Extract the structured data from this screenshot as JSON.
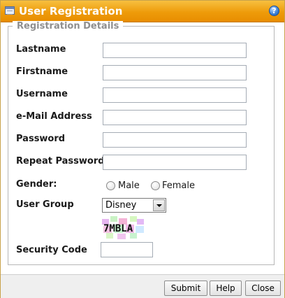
{
  "window": {
    "title": "User Registration",
    "title_icon": "window-form-icon",
    "help_icon": "help-icon",
    "help_glyph": "?"
  },
  "form": {
    "legend": "Registration Details",
    "fields": {
      "lastname": {
        "label": "Lastname",
        "value": ""
      },
      "firstname": {
        "label": "Firstname",
        "value": ""
      },
      "username": {
        "label": "Username",
        "value": ""
      },
      "email": {
        "label": "e-Mail Address",
        "value": ""
      },
      "password": {
        "label": "Password",
        "value": ""
      },
      "repeat_password": {
        "label": "Repeat Password",
        "value": ""
      }
    },
    "gender": {
      "label": "Gender:",
      "options": [
        "Male",
        "Female"
      ],
      "selected": null
    },
    "user_group": {
      "label": "User Group",
      "selected": "Disney"
    },
    "captcha_text": "7MBLA",
    "security_code": {
      "label": "Security Code",
      "value": ""
    }
  },
  "buttons": {
    "submit": "Submit",
    "help": "Help",
    "close": "Close"
  },
  "colors": {
    "titlebar": "#ee9b0a",
    "legend_text": "#8f8f8f"
  }
}
